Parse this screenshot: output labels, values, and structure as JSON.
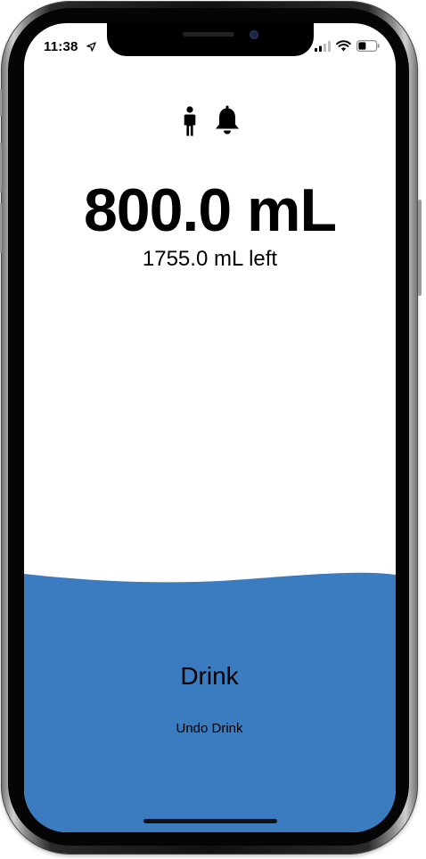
{
  "status_bar": {
    "time": "11:38",
    "icons": [
      "location-arrow-icon",
      "cellular-signal-icon",
      "wifi-icon",
      "battery-icon"
    ]
  },
  "header": {
    "icons": [
      "person-icon",
      "bell-icon"
    ]
  },
  "intake": {
    "amount": "800.0 mL",
    "remaining": "1755.0 mL left",
    "fill_fraction": 0.31
  },
  "actions": {
    "drink_label": "Drink",
    "undo_label": "Undo Drink"
  },
  "colors": {
    "water": "#3b7bbf",
    "background": "#ffffff",
    "text": "#000000"
  }
}
